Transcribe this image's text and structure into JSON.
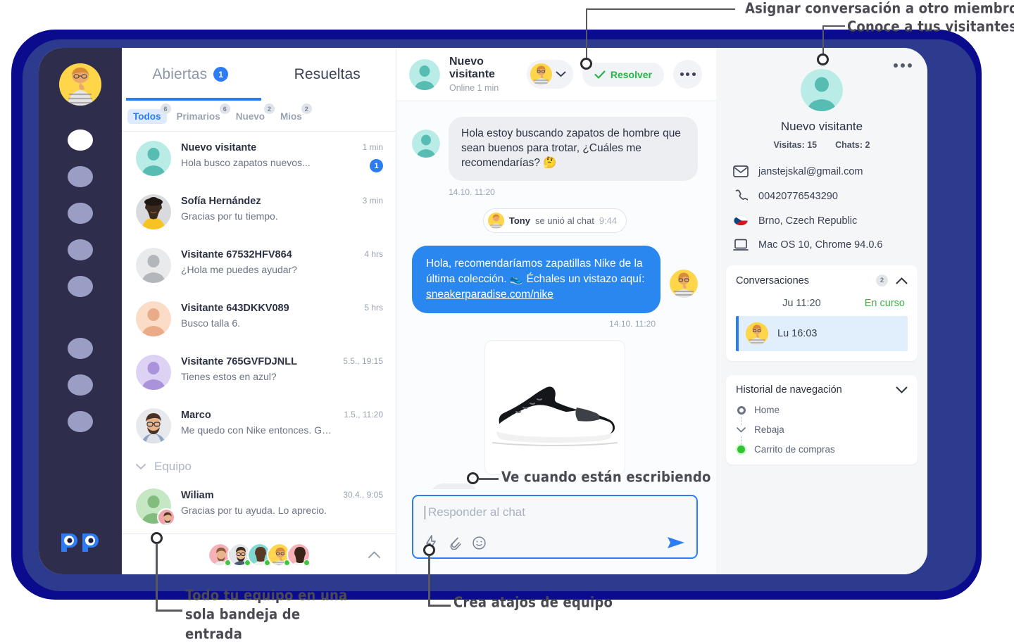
{
  "annotations": [
    {
      "id": "assign-annotation",
      "text": "Asignar conversación a otro miembro del equipo"
    },
    {
      "id": "visitors-annotation",
      "text": "Conoce a tus visitantes"
    },
    {
      "id": "typing-annotation",
      "text": "Ve cuando están escribiendo"
    },
    {
      "id": "inbox-annotation",
      "text": "Todo tu equipo en una sola bandeja de entrada"
    },
    {
      "id": "shortcuts-annotation",
      "text": "Crea atajos de equipo"
    }
  ],
  "colors": {
    "accent": "#2b7cf6",
    "bubble_out": "#2b87f0",
    "success": "#28b446",
    "rail_bg": "#2e2e4c",
    "frame_outer": "#0b0b8e",
    "frame_mid": "#2d3b8e"
  },
  "rail": {
    "avatar_name": "agent-avatar",
    "nav_icons": [
      "nav-dot-1",
      "nav-dot-2",
      "nav-dot-3",
      "nav-dot-4",
      "nav-dot-5"
    ],
    "nav_icons_lower": [
      "nav-dot-6",
      "nav-dot-7",
      "nav-dot-8"
    ],
    "logo": "papergo-logo"
  },
  "list": {
    "tabs": [
      {
        "label": "Abiertas",
        "badge": "1",
        "active": true
      },
      {
        "label": "Resueltas",
        "badge": "",
        "active": false
      }
    ],
    "filters": [
      {
        "label": "Todos",
        "count": "6",
        "active": true
      },
      {
        "label": "Primarios",
        "count": "6",
        "active": false
      },
      {
        "label": "Nuevo",
        "count": "2",
        "active": false
      },
      {
        "label": "Mios",
        "count": "2",
        "active": false
      }
    ],
    "conversations": [
      {
        "name": "Nuevo visitante",
        "message": "Hola busco zapatos nuevos...",
        "time": "1 min",
        "unread": "1",
        "avatar": "teal-placeholder"
      },
      {
        "name": "Sofía Hernández",
        "message": "Gracias por tu tiempo.",
        "time": "3 min",
        "unread": "",
        "avatar": "photo-woman-hat"
      },
      {
        "name": "Visitante 67532HFV864",
        "message": "¿Hola me puedes ayudar?",
        "time": "4 hrs",
        "unread": "",
        "avatar": "gray-placeholder"
      },
      {
        "name": "Visitante 643DKKV089",
        "message": "Busco talla 6.",
        "time": "5 hrs",
        "unread": "",
        "avatar": "peach-placeholder"
      },
      {
        "name": "Visitante 765GVFDJNLL",
        "message": "Tienes estos en azul?",
        "time": "5.5., 19:15",
        "unread": "",
        "avatar": "purple-placeholder"
      },
      {
        "name": "Marco",
        "message": "Me quedo con Nike entonces. Gracias.",
        "time": "1.5., 11:20",
        "unread": "",
        "avatar": "photo-man-glasses"
      }
    ],
    "group_label": "Equipo",
    "team_conversations": [
      {
        "name": "Wiliam",
        "message": "Gracias por tu ayuda. Lo aprecio.",
        "time": "30.4., 9:05",
        "unread": "",
        "avatar": "green-placeholder"
      }
    ],
    "footer_team_count": 5
  },
  "chat": {
    "header": {
      "name": "Nuevo visitante",
      "status": "Online 1 min",
      "assign_icon": "assign-agent-avatar",
      "resolve_label": "Resolver",
      "more_icon": "more-options-icon"
    },
    "messages": [
      {
        "type": "incoming",
        "text": "Hola estoy buscando zapatos de hombre que sean buenos para trotar, ¿Cuáles me recomendarías? 🤔",
        "time": "14.10. 11:20"
      }
    ],
    "system_event": {
      "name": "Tony",
      "text": "se unió al chat",
      "time": "9:44"
    },
    "outgoing": {
      "text_before": "Hola, recomendaríamos zapatillas Nike de la última colección. 👟 Échales un vistazo aquí: ",
      "link": "sneakerparadise.com/nike",
      "time": "14.10. 11:20"
    },
    "attachment": {
      "name": "nike-shoe-image",
      "alt": "Nike running shoe"
    },
    "composer": {
      "placeholder": "Responder al chat",
      "tools": [
        "shortcuts-icon",
        "attachment-icon",
        "emoji-icon"
      ],
      "send_icon": "send-icon"
    }
  },
  "info": {
    "more_icon": "more-options-icon",
    "name": "Nuevo visitante",
    "stats": [
      {
        "label": "Visitas:",
        "value": "15"
      },
      {
        "label": "Chats:",
        "value": "2"
      }
    ],
    "rows": [
      {
        "icon": "email-icon",
        "value": "janstejskal@gmail.com"
      },
      {
        "icon": "phone-icon",
        "value": "00420776543290"
      },
      {
        "icon": "flag-czech-icon",
        "value": "Brno, Czech Republic"
      },
      {
        "icon": "device-icon",
        "value": "Mac OS 10, Chrome 94.0.6"
      }
    ],
    "conversations_card": {
      "title": "Conversaciones",
      "badge": "2",
      "chevron": "chevron-up-icon",
      "rows": [
        {
          "date": "Ju 11:20",
          "status": "En curso",
          "selected": false
        },
        {
          "date": "Lu 16:03",
          "status": "",
          "selected": true
        }
      ]
    },
    "history_card": {
      "title": "Historial de navegación",
      "chevron": "chevron-down-icon",
      "items": [
        {
          "label": "Home",
          "marker": "ring"
        },
        {
          "label": "Rebaja",
          "marker": "chevron"
        },
        {
          "label": "Carrito de compras",
          "marker": "green-dot"
        }
      ]
    }
  }
}
